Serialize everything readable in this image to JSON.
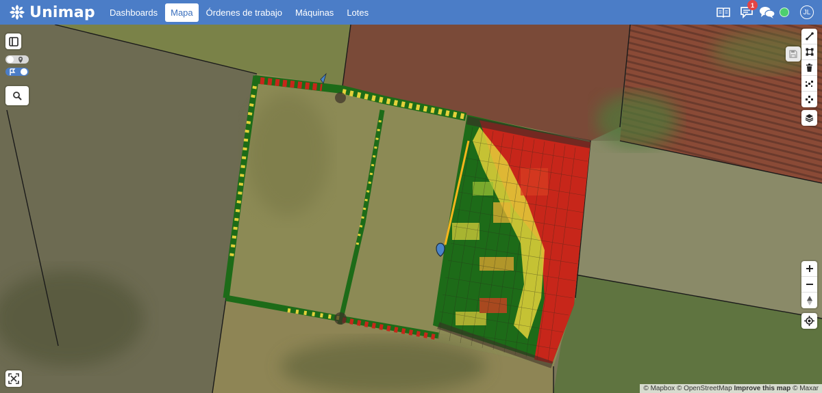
{
  "app": {
    "name": "Unimap"
  },
  "nav": {
    "links": [
      {
        "label": "Dashboards",
        "active": false
      },
      {
        "label": "Mapa",
        "active": true
      },
      {
        "label": "Órdenes de trabajo",
        "active": false
      },
      {
        "label": "Máquinas",
        "active": false
      },
      {
        "label": "Lotes",
        "active": false
      }
    ],
    "notification_count": "1",
    "user_initials": "JL"
  },
  "map": {
    "attribution": {
      "mapbox": "© Mapbox",
      "osm": "© OpenStreetMap",
      "improve": "Improve this map",
      "maxar": "© Maxar"
    },
    "layer_colors": {
      "low": "#d42a1e",
      "mid": "#e6d639",
      "high": "#1d7a1a",
      "accent": "#f7b51c",
      "marker": "#4a84c9"
    },
    "icons": {
      "left": [
        "sidebar-toggle-icon",
        "search-icon",
        "fullscreen-icon"
      ],
      "draw_toolbar": [
        "draw-line-icon",
        "draw-polygon-icon",
        "trash-icon",
        "combine-icon",
        "uncombine-icon"
      ],
      "right_other": [
        "layers-icon",
        "zoom-in-icon",
        "zoom-out-icon",
        "compass-icon",
        "geolocate-icon"
      ]
    }
  }
}
